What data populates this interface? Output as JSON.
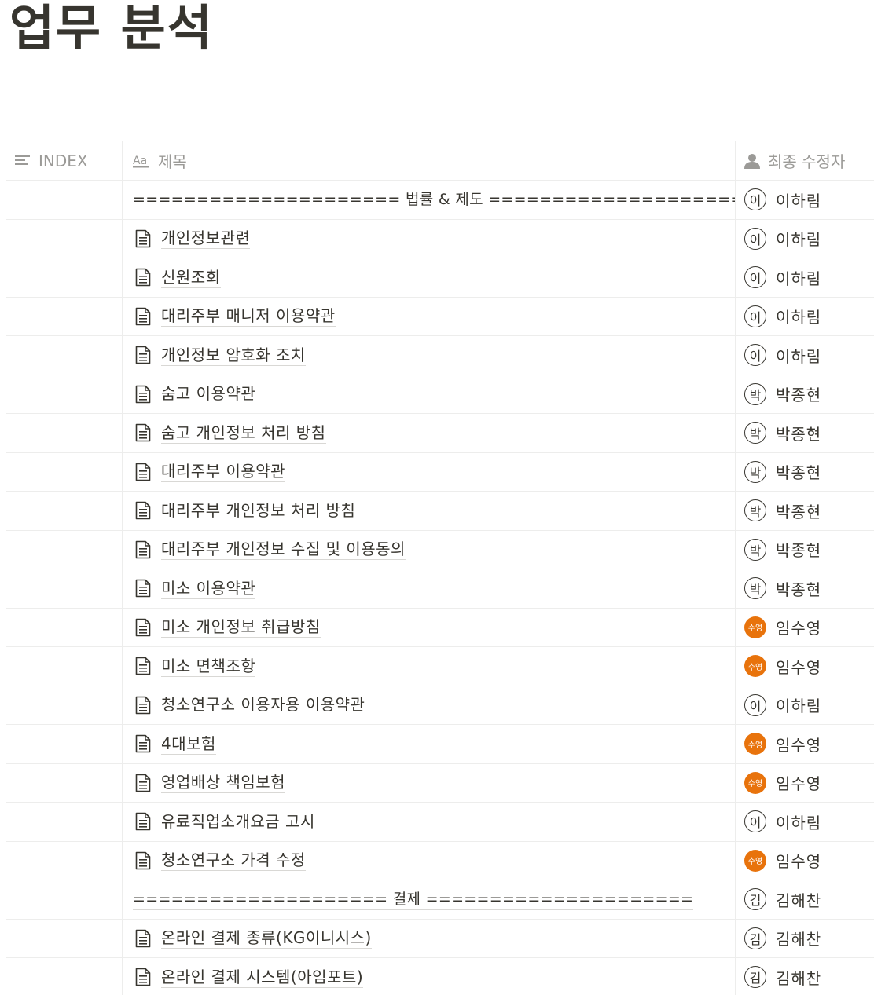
{
  "page": {
    "title": "업무 분석"
  },
  "table": {
    "headers": {
      "index": "INDEX",
      "title": "제목",
      "editor": "최종 수정자"
    },
    "rows": [
      {
        "type": "separator",
        "title": "===================== 법률 & 제도 =====================",
        "avatar": "이",
        "avatar_style": "letter",
        "editor": "이하림"
      },
      {
        "type": "page",
        "title": "개인정보관련",
        "avatar": "이",
        "avatar_style": "letter",
        "editor": "이하림"
      },
      {
        "type": "page",
        "title": "신원조회",
        "avatar": "이",
        "avatar_style": "letter",
        "editor": "이하림"
      },
      {
        "type": "page",
        "title": "대리주부 매니저 이용약관",
        "avatar": "이",
        "avatar_style": "letter",
        "editor": "이하림"
      },
      {
        "type": "page",
        "title": "개인정보 암호화 조치",
        "avatar": "이",
        "avatar_style": "letter",
        "editor": "이하림"
      },
      {
        "type": "page",
        "title": "숨고 이용약관",
        "avatar": "박",
        "avatar_style": "letter",
        "editor": "박종현"
      },
      {
        "type": "page",
        "title": "숨고 개인정보 처리 방침",
        "avatar": "박",
        "avatar_style": "letter",
        "editor": "박종현"
      },
      {
        "type": "page",
        "title": "대리주부 이용약관",
        "avatar": "박",
        "avatar_style": "letter",
        "editor": "박종현"
      },
      {
        "type": "page",
        "title": "대리주부 개인정보 처리 방침",
        "avatar": "박",
        "avatar_style": "letter",
        "editor": "박종현"
      },
      {
        "type": "page",
        "title": "대리주부 개인정보 수집 및 이용동의",
        "avatar": "박",
        "avatar_style": "letter",
        "editor": "박종현"
      },
      {
        "type": "page",
        "title": "미소 이용약관",
        "avatar": "박",
        "avatar_style": "letter",
        "editor": "박종현"
      },
      {
        "type": "page",
        "title": "미소 개인정보 취급방침",
        "avatar": "수영",
        "avatar_style": "photo",
        "editor": "임수영"
      },
      {
        "type": "page",
        "title": "미소 면책조항",
        "avatar": "수영",
        "avatar_style": "photo",
        "editor": "임수영"
      },
      {
        "type": "page",
        "title": "청소연구소 이용자용 이용약관",
        "avatar": "이",
        "avatar_style": "letter",
        "editor": "이하림"
      },
      {
        "type": "page",
        "title": "4대보험",
        "avatar": "수영",
        "avatar_style": "photo",
        "editor": "임수영"
      },
      {
        "type": "page",
        "title": "영업배상 책임보험",
        "avatar": "수영",
        "avatar_style": "photo",
        "editor": "임수영"
      },
      {
        "type": "page",
        "title": "유료직업소개요금 고시",
        "avatar": "이",
        "avatar_style": "letter",
        "editor": "이하림"
      },
      {
        "type": "page",
        "title": "청소연구소 가격 수정",
        "avatar": "수영",
        "avatar_style": "photo",
        "editor": "임수영"
      },
      {
        "type": "separator",
        "title": "==================== 결제 =====================",
        "avatar": "김",
        "avatar_style": "letter",
        "editor": "김해찬"
      },
      {
        "type": "page",
        "title": "온라인 결제 종류(KG이니시스)",
        "avatar": "김",
        "avatar_style": "letter",
        "editor": "김해찬"
      },
      {
        "type": "page",
        "title": "온라인 결제 시스템(아임포트)",
        "avatar": "김",
        "avatar_style": "letter",
        "editor": "김해찬"
      }
    ]
  },
  "icons": {
    "index_header": "list-lines-icon",
    "title_header": "text-aa-icon",
    "editor_header": "person-icon",
    "page": "document-icon"
  },
  "colors": {
    "avatar_photo_bg": "#e8730c",
    "text": "#37352f",
    "header_text": "#9b9a97"
  }
}
